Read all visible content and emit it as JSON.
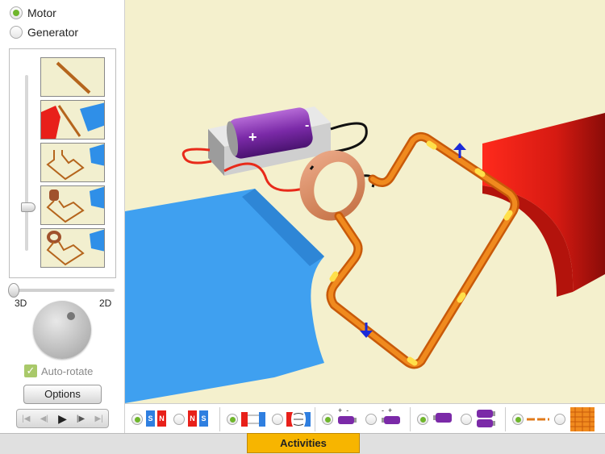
{
  "mode": {
    "options": [
      {
        "label": "Motor",
        "selected": true
      },
      {
        "label": "Generator",
        "selected": false
      }
    ]
  },
  "view": {
    "label_3d": "3D",
    "label_2d": "2D",
    "view_amount": 0
  },
  "thumbnails": [
    "straight-wire",
    "wire-between-magnets",
    "loop-between-magnets",
    "loop-with-commutator",
    "loop-with-split-ring"
  ],
  "auto_rotate": {
    "label": "Auto-rotate",
    "checked": true
  },
  "options_label": "Options",
  "toolbar_groups": [
    {
      "name": "magnet-polarity",
      "selected": 0,
      "icons": [
        [
          "S",
          "N"
        ],
        [
          "N",
          "S"
        ]
      ]
    },
    {
      "name": "magnet-shape",
      "selected": 0,
      "icons": [
        "flat-poles",
        "curved-poles"
      ]
    },
    {
      "name": "battery-direction",
      "selected": 0,
      "icons": [
        [
          "+",
          "-"
        ],
        [
          "-",
          "+"
        ]
      ]
    },
    {
      "name": "battery-count",
      "selected": 0,
      "icons": [
        "one-battery",
        "two-batteries"
      ]
    },
    {
      "name": "coil-turns",
      "selected": 0,
      "icons": [
        "single-loop",
        "multi-loop"
      ]
    }
  ],
  "magnet_labels": {
    "s": "S",
    "n": "N"
  },
  "battery_labels": {
    "plus": "+",
    "minus": "-"
  },
  "scene": {
    "battery_plus": "+",
    "battery_minus": "-"
  },
  "activities_label": "Activities",
  "colors": {
    "accent_green": "#6fb62c",
    "activities": "#f7b500",
    "scene_bg": "#f4f0cd",
    "north_pole": "#e8201a",
    "south_pole": "#3fa0f0"
  }
}
